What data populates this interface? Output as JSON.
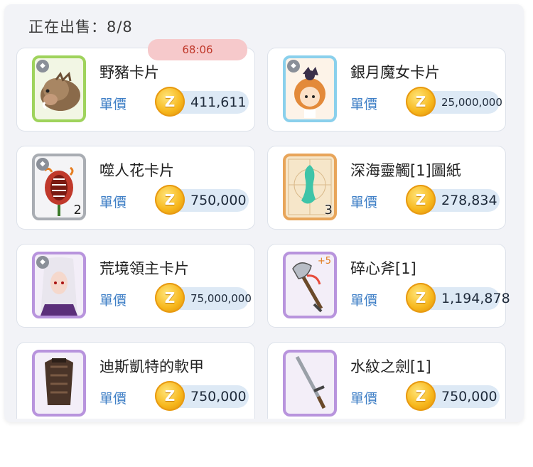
{
  "header": {
    "title": "正在出售：8/8"
  },
  "timer": {
    "text": "68:06"
  },
  "currency_icon": "zeny-coin-icon",
  "colors": {
    "unit_label": "#3f7fc6",
    "timer_bg": "#f6c9cb",
    "timer_text": "#c0392b",
    "price_pill": "#dde9f5"
  },
  "items": [
    {
      "name": "野豬卡片",
      "unit_label": "單價",
      "price": "411,611",
      "frame": "green",
      "icon": "wild-boar-card-icon"
    },
    {
      "name": "銀月魔女卡片",
      "unit_label": "單價",
      "price": "25,000,000",
      "frame": "blue",
      "icon": "silver-moon-witch-card-icon"
    },
    {
      "name": "噬人花卡片",
      "unit_label": "單價",
      "price": "750,000",
      "quantity": "2",
      "frame": "gray",
      "icon": "man-eater-flower-card-icon"
    },
    {
      "name": "深海靈觸[1]圖紙",
      "unit_label": "單價",
      "price": "278,834",
      "quantity": "3",
      "frame": "orange",
      "icon": "blueprint-icon"
    },
    {
      "name": "荒境領主卡片",
      "unit_label": "單價",
      "price": "75,000,000",
      "frame": "purple",
      "icon": "wasteland-lord-card-icon"
    },
    {
      "name": "碎心斧[1]",
      "unit_label": "單價",
      "price": "1,194,878",
      "refine": "+5",
      "frame": "purple",
      "icon": "axe-icon"
    },
    {
      "name": "迪斯凱特的軟甲",
      "unit_label": "單價",
      "price": "750,000",
      "frame": "purple",
      "icon": "armor-icon"
    },
    {
      "name": "水紋之劍[1]",
      "unit_label": "單價",
      "price": "750,000",
      "frame": "purple",
      "icon": "sword-icon"
    }
  ]
}
